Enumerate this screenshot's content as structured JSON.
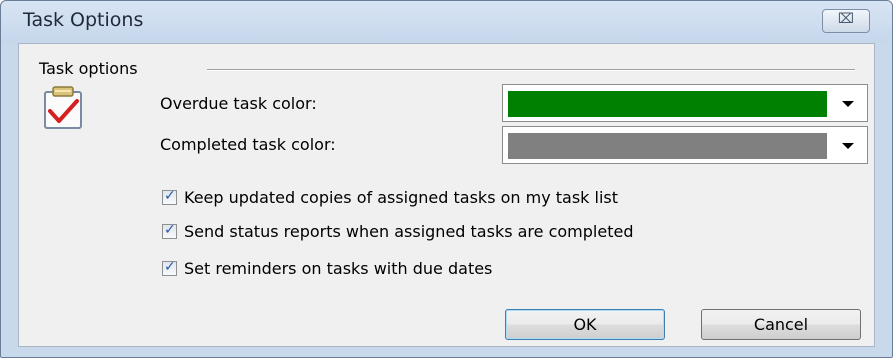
{
  "window": {
    "title": "Task Options",
    "close_glyph": "⌧"
  },
  "group": {
    "label": "Task options",
    "icon": "task-clipboard-check-icon"
  },
  "overdue": {
    "label": "Overdue task color:",
    "color": "#008000"
  },
  "completed": {
    "label": "Completed task color:",
    "color": "#808080"
  },
  "options": [
    {
      "label": "Keep updated copies of assigned tasks on my task list",
      "checked": true
    },
    {
      "label": "Send status reports when assigned tasks are completed",
      "checked": true
    },
    {
      "label": "Set reminders on tasks with due dates",
      "checked": true
    }
  ],
  "checkmark": "✓",
  "buttons": {
    "ok": "OK",
    "cancel": "Cancel"
  }
}
